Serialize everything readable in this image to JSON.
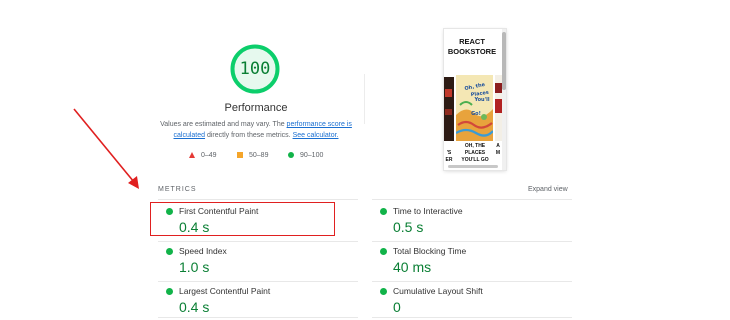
{
  "score": {
    "value": "100",
    "color": "#0cce6b"
  },
  "performance": {
    "title": "Performance",
    "desc_prefix": "Values are estimated and may vary. The ",
    "link1_a": "performance score is",
    "link1_b": "calculated",
    "desc_mid": " directly from these metrics. ",
    "link2": "See calculator."
  },
  "legend": [
    {
      "icon": "triangle",
      "label": "0–49",
      "color": "#e53935"
    },
    {
      "icon": "square",
      "label": "50–89",
      "color": "#f5a52a"
    },
    {
      "icon": "circle",
      "label": "90–100",
      "color": "#11b349"
    }
  ],
  "screenshot": {
    "title_line1": "REACT",
    "title_line2": "BOOKSTORE",
    "book_cover_text": [
      "Oh, the",
      "Places",
      "You'll",
      "Go!"
    ],
    "caption": [
      "OH, THE",
      "PLACES",
      "YOU'LL GO"
    ],
    "left_cut_caption": [
      "'S",
      "ER"
    ],
    "right_cut_caption": [
      "A",
      "M"
    ]
  },
  "metrics": {
    "header": "METRICS",
    "expand": "Expand view",
    "items": [
      {
        "label": "First Contentful Paint",
        "value": "0.4 s"
      },
      {
        "label": "Time to Interactive",
        "value": "0.5 s"
      },
      {
        "label": "Speed Index",
        "value": "1.0 s"
      },
      {
        "label": "Total Blocking Time",
        "value": "40 ms"
      },
      {
        "label": "Largest Contentful Paint",
        "value": "0.4 s"
      },
      {
        "label": "Cumulative Layout Shift",
        "value": "0"
      }
    ]
  }
}
